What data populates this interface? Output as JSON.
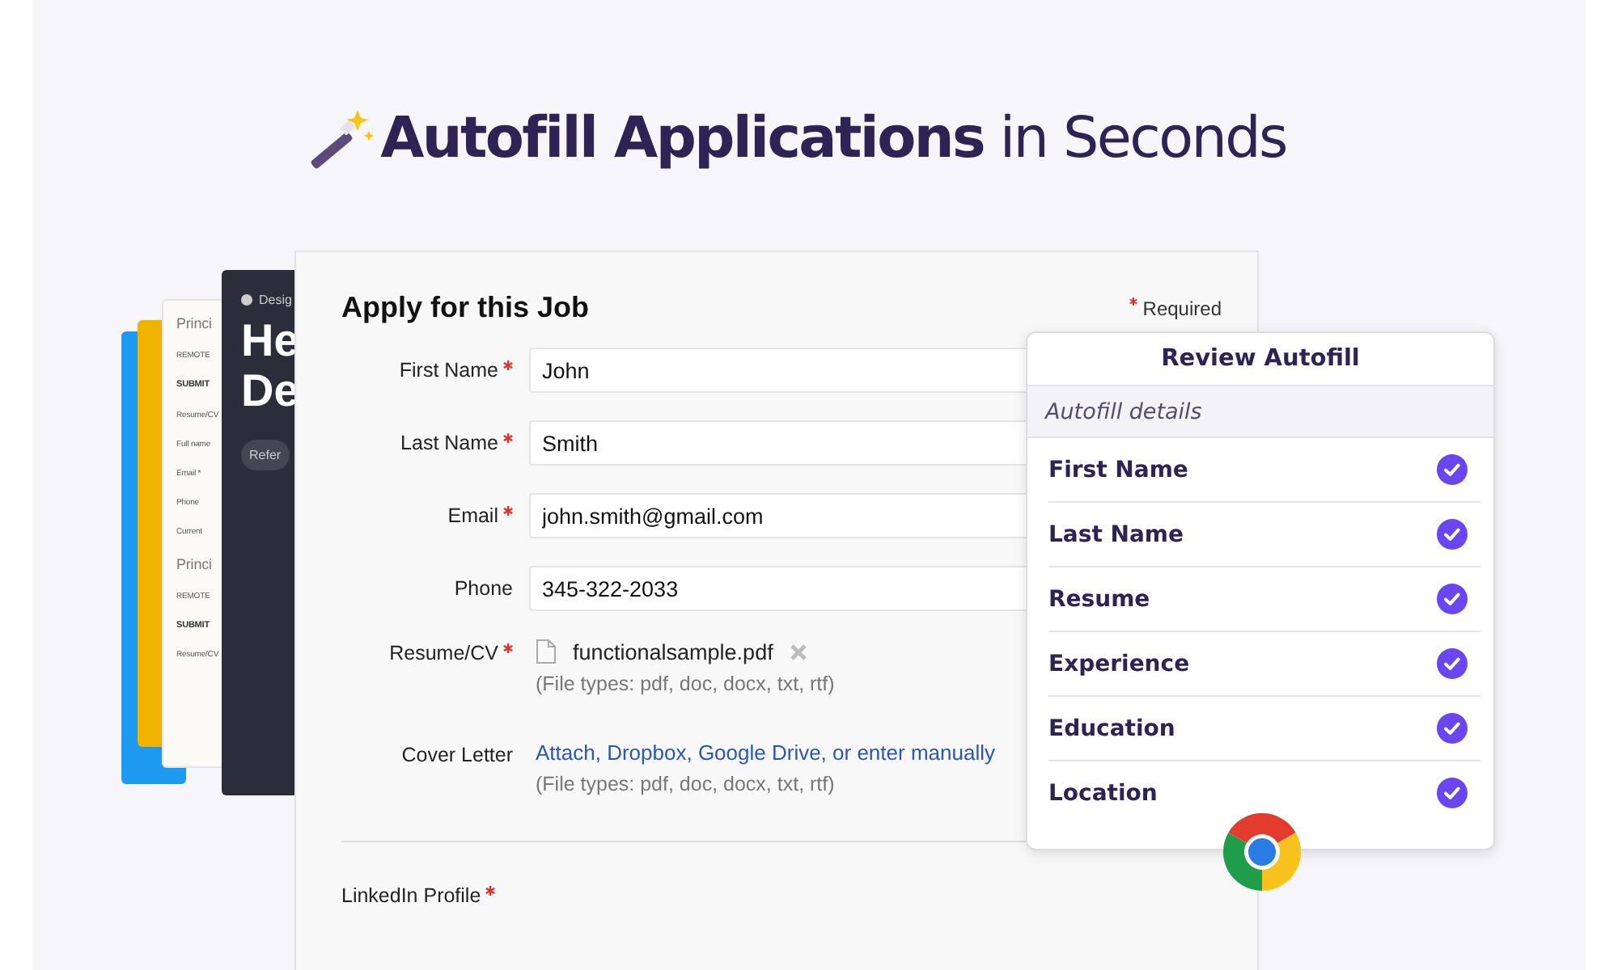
{
  "headline": "**Autofill Applications** in Seconds",
  "back_cards": [
    {
      "kind": "plain",
      "color": "#1e9bf0"
    },
    {
      "kind": "plain",
      "color": "#f0b400"
    },
    {
      "kind": "form",
      "lines": [
        {
          "kind": "title",
          "text": "Princi"
        },
        {
          "kind": "meta",
          "text": "REMOTE"
        },
        {
          "kind": "section",
          "text": "SUBMIT"
        },
        {
          "kind": "meta",
          "text": "Resume/CV"
        },
        {
          "kind": "meta",
          "text": "Full name"
        },
        {
          "kind": "meta",
          "text": "Email *"
        },
        {
          "kind": "meta",
          "text": "Phone"
        },
        {
          "kind": "meta",
          "text": "Current"
        },
        {
          "kind": "title",
          "text": "Princi"
        },
        {
          "kind": "meta",
          "text": "REMOTE"
        },
        {
          "kind": "section",
          "text": "SUBMIT"
        },
        {
          "kind": "meta",
          "text": "Resume/CV"
        }
      ]
    },
    {
      "kind": "dark",
      "tag": "Desig",
      "lines": [
        "He",
        "De"
      ],
      "button": "Refer"
    }
  ],
  "form": {
    "title": "Apply for this Job",
    "required_note": "Required",
    "fields": [
      {
        "kind": "text",
        "label": "First Name",
        "required": true,
        "value": "John"
      },
      {
        "kind": "text",
        "label": "Last Name",
        "required": true,
        "value": "Smith"
      },
      {
        "kind": "text",
        "label": "Email",
        "required": true,
        "value": "john.smith@gmail.com"
      },
      {
        "kind": "text",
        "label": "Phone",
        "required": false,
        "value": "345-322-2033"
      },
      {
        "kind": "file",
        "label": "Resume/CV",
        "required": true,
        "file": "functionalsample.pdf",
        "hint": "(File types: pdf, doc, docx, txt, rtf)"
      },
      {
        "kind": "links",
        "label": "Cover Letter",
        "required": false,
        "link": "Attach, Dropbox, Google Drive, or enter manually",
        "hint": "(File types: pdf, doc, docx, txt, rtf)"
      }
    ],
    "extra_field": {
      "label": "LinkedIn Profile",
      "required": true
    }
  },
  "review": {
    "title": "Review Autofill",
    "section": "Autofill details",
    "items": [
      {
        "label": "First Name",
        "checked": true
      },
      {
        "label": "Last Name",
        "checked": true
      },
      {
        "label": "Resume",
        "checked": true
      },
      {
        "label": "Experience",
        "checked": true
      },
      {
        "label": "Education",
        "checked": true
      },
      {
        "label": "Location",
        "checked": true
      }
    ]
  }
}
